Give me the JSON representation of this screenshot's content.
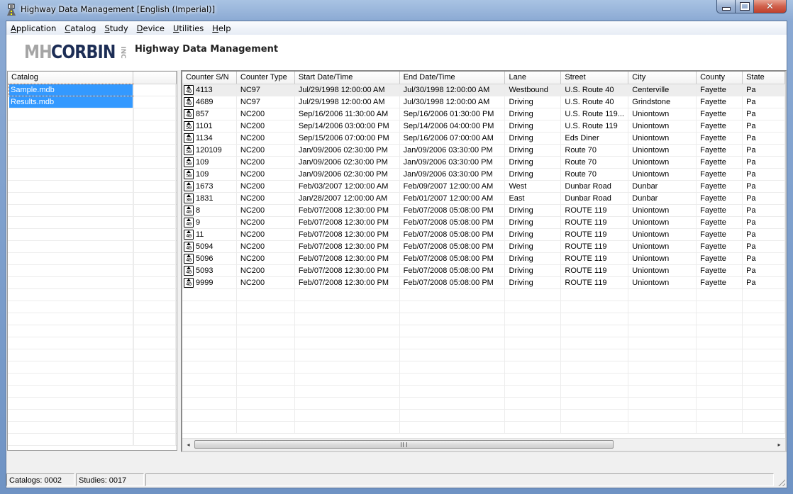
{
  "window": {
    "title": "Highway Data Management [English (Imperial)]",
    "controls": {
      "minimize": "minimize",
      "maximize": "maximize",
      "close": "close"
    }
  },
  "menu": [
    {
      "label": "Application",
      "accel": "A",
      "rest": "pplication"
    },
    {
      "label": "Catalog",
      "accel": "C",
      "rest": "atalog"
    },
    {
      "label": "Study",
      "accel": "S",
      "rest": "tudy"
    },
    {
      "label": "Device",
      "accel": "D",
      "rest": "evice"
    },
    {
      "label": "Utilities",
      "accel": "U",
      "rest": "tilities"
    },
    {
      "label": "Help",
      "accel": "H",
      "rest": "elp"
    }
  ],
  "banner": {
    "logo_mh": "MH",
    "logo_corbin": "CORBIN",
    "logo_inc": "INC",
    "title": "Highway Data Management"
  },
  "catalog": {
    "header": "Catalog",
    "items": [
      {
        "name": "Sample.mdb",
        "selected": true
      },
      {
        "name": "Results.mdb",
        "selected": true
      }
    ]
  },
  "studies": {
    "columns": [
      "Counter S/N",
      "Counter Type",
      "Start Date/Time",
      "End Date/Time",
      "Lane",
      "Street",
      "City",
      "County",
      "State"
    ],
    "rows": [
      {
        "icon": "40",
        "sn": "4113",
        "type": "NC97",
        "start": "Jul/29/1998 12:00:00 AM",
        "end": "Jul/30/1998 12:00:00 AM",
        "lane": "Westbound",
        "street": "U.S. Route 40",
        "city": "Centerville",
        "county": "Fayette",
        "state": "Pa"
      },
      {
        "icon": "40",
        "sn": "4689",
        "type": "NC97",
        "start": "Jul/29/1998 12:00:00 AM",
        "end": "Jul/30/1998 12:00:00 AM",
        "lane": "Driving",
        "street": "U.S. Route 40",
        "city": "Grindstone",
        "county": "Fayette",
        "state": "Pa"
      },
      {
        "icon": "40",
        "sn": "857",
        "type": "NC200",
        "start": "Sep/16/2006 11:30:00 AM",
        "end": "Sep/16/2006 01:30:00 PM",
        "lane": "Driving",
        "street": "U.S. Route 119...",
        "city": "Uniontown",
        "county": "Fayette",
        "state": "Pa"
      },
      {
        "icon": "50",
        "sn": "1101",
        "type": "NC200",
        "start": "Sep/14/2006 03:00:00 PM",
        "end": "Sep/14/2006 04:00:00 PM",
        "lane": "Driving",
        "street": "U.S. Route 119",
        "city": "Uniontown",
        "county": "Fayette",
        "state": "Pa"
      },
      {
        "icon": "40",
        "sn": "1134",
        "type": "NC200",
        "start": "Sep/15/2006 07:00:00 PM",
        "end": "Sep/16/2006 07:00:00 AM",
        "lane": "Driving",
        "street": "Eds Diner",
        "city": "Uniontown",
        "county": "Fayette",
        "state": "Pa"
      },
      {
        "icon": "50",
        "sn": "120109",
        "type": "NC200",
        "start": "Jan/09/2006 02:30:00 PM",
        "end": "Jan/09/2006 03:30:00 PM",
        "lane": "Driving",
        "street": "Route 70",
        "city": "Uniontown",
        "county": "Fayette",
        "state": "Pa"
      },
      {
        "icon": "50",
        "sn": "109",
        "type": "NC200",
        "start": "Jan/09/2006 02:30:00 PM",
        "end": "Jan/09/2006 03:30:00 PM",
        "lane": "Driving",
        "street": "Route 70",
        "city": "Uniontown",
        "county": "Fayette",
        "state": "Pa"
      },
      {
        "icon": "50",
        "sn": "109",
        "type": "NC200",
        "start": "Jan/09/2006 02:30:00 PM",
        "end": "Jan/09/2006 03:30:00 PM",
        "lane": "Driving",
        "street": "Route 70",
        "city": "Uniontown",
        "county": "Fayette",
        "state": "Pa"
      },
      {
        "icon": "30",
        "sn": "1673",
        "type": "NC200",
        "start": "Feb/03/2007 12:00:00 AM",
        "end": "Feb/09/2007 12:00:00 AM",
        "lane": "West",
        "street": "Dunbar Road",
        "city": "Dunbar",
        "county": "Fayette",
        "state": "Pa"
      },
      {
        "icon": "30",
        "sn": "1831",
        "type": "NC200",
        "start": "Jan/28/2007 12:00:00 AM",
        "end": "Feb/01/2007 12:00:00 AM",
        "lane": "East",
        "street": "Dunbar Road",
        "city": "Dunbar",
        "county": "Fayette",
        "state": "Pa"
      },
      {
        "icon": "40",
        "sn": "8",
        "type": "NC200",
        "start": "Feb/07/2008 12:30:00 PM",
        "end": "Feb/07/2008 05:08:00 PM",
        "lane": "Driving",
        "street": "ROUTE 119",
        "city": "Uniontown",
        "county": "Fayette",
        "state": "Pa"
      },
      {
        "icon": "40",
        "sn": "9",
        "type": "NC200",
        "start": "Feb/07/2008 12:30:00 PM",
        "end": "Feb/07/2008 05:08:00 PM",
        "lane": "Driving",
        "street": "ROUTE 119",
        "city": "Uniontown",
        "county": "Fayette",
        "state": "Pa"
      },
      {
        "icon": "40",
        "sn": "11",
        "type": "NC200",
        "start": "Feb/07/2008 12:30:00 PM",
        "end": "Feb/07/2008 05:08:00 PM",
        "lane": "Driving",
        "street": "ROUTE 119",
        "city": "Uniontown",
        "county": "Fayette",
        "state": "Pa"
      },
      {
        "icon": "40",
        "sn": "5094",
        "type": "NC200",
        "start": "Feb/07/2008 12:30:00 PM",
        "end": "Feb/07/2008 05:08:00 PM",
        "lane": "Driving",
        "street": "ROUTE 119",
        "city": "Uniontown",
        "county": "Fayette",
        "state": "Pa"
      },
      {
        "icon": "40",
        "sn": "5096",
        "type": "NC200",
        "start": "Feb/07/2008 12:30:00 PM",
        "end": "Feb/07/2008 05:08:00 PM",
        "lane": "Driving",
        "street": "ROUTE 119",
        "city": "Uniontown",
        "county": "Fayette",
        "state": "Pa"
      },
      {
        "icon": "40",
        "sn": "5093",
        "type": "NC200",
        "start": "Feb/07/2008 12:30:00 PM",
        "end": "Feb/07/2008 05:08:00 PM",
        "lane": "Driving",
        "street": "ROUTE 119",
        "city": "Uniontown",
        "county": "Fayette",
        "state": "Pa"
      },
      {
        "icon": "40",
        "sn": "9999",
        "type": "NC200",
        "start": "Feb/07/2008 12:30:00 PM",
        "end": "Feb/07/2008 05:08:00 PM",
        "lane": "Driving",
        "street": "ROUTE 119",
        "city": "Uniontown",
        "county": "Fayette",
        "state": "Pa"
      }
    ],
    "scroll": {
      "left_arrow": "◂",
      "right_arrow": "▸",
      "position_fraction": 0.0
    }
  },
  "status": {
    "catalogs": "Catalogs: 0002",
    "studies": "Studies: 0017",
    "message": ""
  },
  "colors": {
    "selection": "#3399ff",
    "logo_dark": "#1c2d55",
    "logo_grey": "#a5a5a5"
  }
}
